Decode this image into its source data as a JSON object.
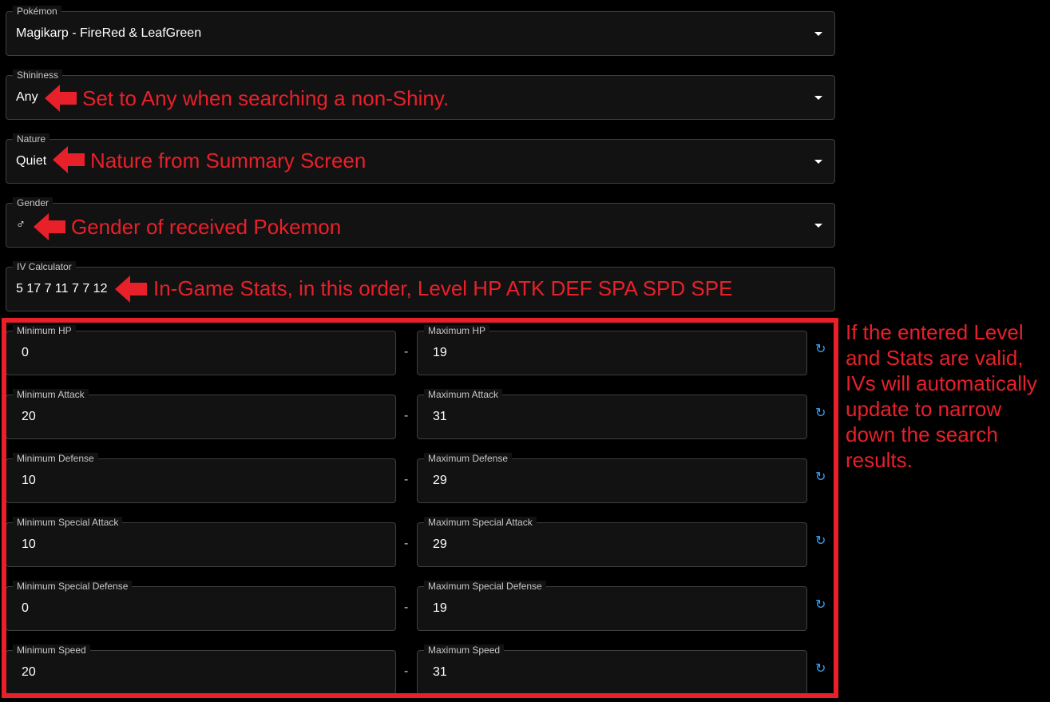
{
  "fields": {
    "pokemon": {
      "label": "Pokémon",
      "value": "Magikarp - FireRed & LeafGreen"
    },
    "shininess": {
      "label": "Shininess",
      "value": "Any"
    },
    "nature": {
      "label": "Nature",
      "value": "Quiet"
    },
    "gender": {
      "label": "Gender",
      "value": "♂"
    },
    "iv_calculator": {
      "label": "IV Calculator",
      "value": "5 17 7 11 7 7 12"
    }
  },
  "annotations": {
    "shininess": "Set to Any when searching a non-Shiny.",
    "nature": "Nature from Summary Screen",
    "gender": "Gender of received Pokemon",
    "iv_calculator": "In-Game Stats, in this order, Level HP ATK DEF SPA SPD SPE",
    "iv_note": "If the entered Level and Stats are valid, IVs will automatically update to narrow down the search results."
  },
  "iv_ranges": [
    {
      "min_label": "Minimum HP",
      "min_value": "0",
      "separator": "-",
      "max_label": "Maximum HP",
      "max_value": "19"
    },
    {
      "min_label": "Minimum Attack",
      "min_value": "20",
      "separator": "-",
      "max_label": "Maximum Attack",
      "max_value": "31"
    },
    {
      "min_label": "Minimum Defense",
      "min_value": "10",
      "separator": "-",
      "max_label": "Maximum Defense",
      "max_value": "29"
    },
    {
      "min_label": "Minimum Special Attack",
      "min_value": "10",
      "separator": "-",
      "max_label": "Maximum Special Attack",
      "max_value": "29"
    },
    {
      "min_label": "Minimum Special Defense",
      "min_value": "0",
      "separator": "-",
      "max_label": "Maximum Special Defense",
      "max_value": "19"
    },
    {
      "min_label": "Minimum Speed",
      "min_value": "20",
      "separator": "-",
      "max_label": "Maximum Speed",
      "max_value": "31"
    }
  ],
  "icons": {
    "dropdown": "chevron-down-icon",
    "reset": "reset-icon",
    "annotation_arrow": "red-left-arrow-icon",
    "reset_glyph": "↻"
  },
  "colors": {
    "background": "#000000",
    "field_background": "#121212",
    "field_border": "#3f3f3f",
    "label": "#c8c8c8",
    "text": "#ffffff",
    "annotation": "#e8202a",
    "reset_icon": "#3a9ff5"
  }
}
